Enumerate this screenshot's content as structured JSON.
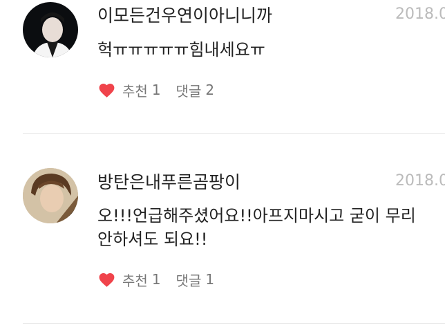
{
  "comments": [
    {
      "username": "이모든건우연이아니니까",
      "date": "2018.0",
      "lines": [
        "헉ㅠㅠㅠㅠㅠ힘내세요ㅠ"
      ],
      "like_label": "추천",
      "like_count": "1",
      "reply_label": "댓글",
      "reply_count": "2"
    },
    {
      "username": "방탄은내푸른곰팡이",
      "date": "2018.0",
      "lines": [
        "오!!!언급해주셨어요!!아프지마시고 굳이 무리",
        "안하셔도 되요!!"
      ],
      "like_label": "추천",
      "like_count": "1",
      "reply_label": "댓글",
      "reply_count": "1"
    }
  ],
  "colors": {
    "heart": "#f0434b",
    "text": "#222222",
    "meta": "#777777",
    "date": "#bbbbbb",
    "divider": "#e5e5e5"
  }
}
